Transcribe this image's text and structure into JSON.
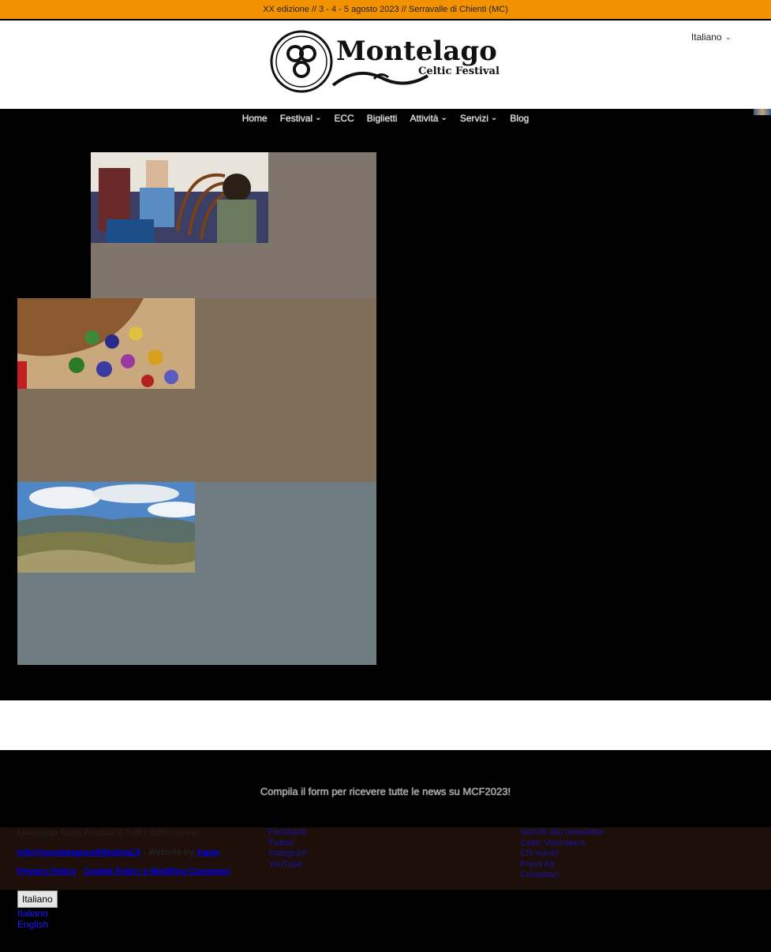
{
  "topbar": {
    "text": "XX edizione // 3 - 4 - 5 agosto 2023 // Serravalle di Chienti (MC)"
  },
  "header": {
    "logo": {
      "name": "Montelago",
      "tagline": "Celtic Festival"
    },
    "language": "Italiano"
  },
  "nav": {
    "items": [
      {
        "label": "Home",
        "dropdown": false
      },
      {
        "label": "Festival",
        "dropdown": true
      },
      {
        "label": "ECC",
        "dropdown": false
      },
      {
        "label": "Biglietti",
        "dropdown": false
      },
      {
        "label": "Attività",
        "dropdown": true
      },
      {
        "label": "Servizi",
        "dropdown": true
      },
      {
        "label": "Blog",
        "dropdown": false
      }
    ]
  },
  "cards": [
    {
      "image": "harp-workshop-photo",
      "bg": "#7f756c"
    },
    {
      "image": "dice-and-pouch-photo",
      "bg": "#7f6e5a"
    },
    {
      "image": "mountain-landscape-photo",
      "bg": "#6f7d82"
    }
  ],
  "newsletter": {
    "text": "Compila il form per ricevere tutte le news su MCF2023!"
  },
  "footer": {
    "copyright": "Montelago Celtic Festival © Tutti i diritti riservati",
    "email": "info@montelagoceltifestival.it",
    "website_by_prefix": " - Website by ",
    "website_by_link": "Yanio",
    "privacy": "Privacy Policy",
    "separator": " - ",
    "cookie": "Cookie Policy e Modifica Consenso",
    "social": [
      "Facebook",
      "Twitter",
      "Instagram",
      "YouTube"
    ],
    "links": [
      "Iscriviti alla newsletter",
      "Celtic Volunteers",
      "Chi siamo",
      "Press Kit",
      "Contattaci"
    ]
  },
  "language_switcher": {
    "current": "Italiano",
    "options": [
      "Italiano",
      "English"
    ]
  },
  "colors": {
    "accent": "#f39200",
    "footer_bg": "#1e0f0a"
  }
}
